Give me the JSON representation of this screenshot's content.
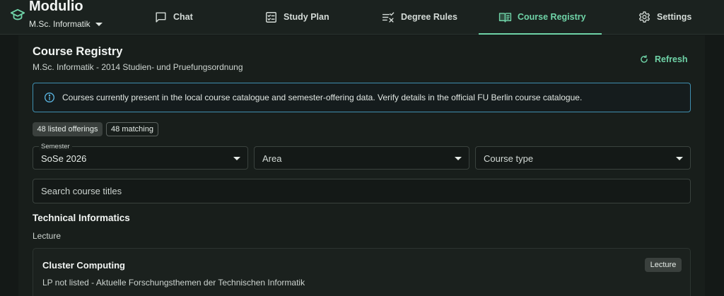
{
  "app": {
    "name": "Modulio",
    "program": "M.Sc. Informatik"
  },
  "nav": {
    "tabs": [
      {
        "label": "Chat",
        "icon": "chat-icon"
      },
      {
        "label": "Study Plan",
        "icon": "checklist-icon"
      },
      {
        "label": "Degree Rules",
        "icon": "rules-icon"
      },
      {
        "label": "Course Registry",
        "icon": "book-icon",
        "active": true
      },
      {
        "label": "Settings",
        "icon": "gear-icon"
      }
    ]
  },
  "page": {
    "title": "Course Registry",
    "subtitle": "M.Sc. Informatik - 2014 Studien- und Pruefungsordnung",
    "refresh_label": "Refresh"
  },
  "info": {
    "text": "Courses currently present in the local course catalogue and semester-offering data. Verify details in the official FU Berlin course catalogue."
  },
  "chips": {
    "listed": "48 listed offerings",
    "matching": "48 matching"
  },
  "filters": {
    "semester_label": "Semester",
    "semester_value": "SoSe 2026",
    "area_placeholder": "Area",
    "course_type_placeholder": "Course type",
    "search_placeholder": "Search course titles"
  },
  "groups": [
    {
      "area": "Technical Informatics",
      "type": "Lecture",
      "courses": [
        {
          "title": "Cluster Computing",
          "meta": "LP not listed - Aktuelle Forschungsthemen der Technischen Informatik",
          "badge": "Lecture"
        }
      ]
    }
  ],
  "colors": {
    "accent": "#6fd3a7",
    "background": "#141917",
    "info_border": "#3f8fb0"
  }
}
